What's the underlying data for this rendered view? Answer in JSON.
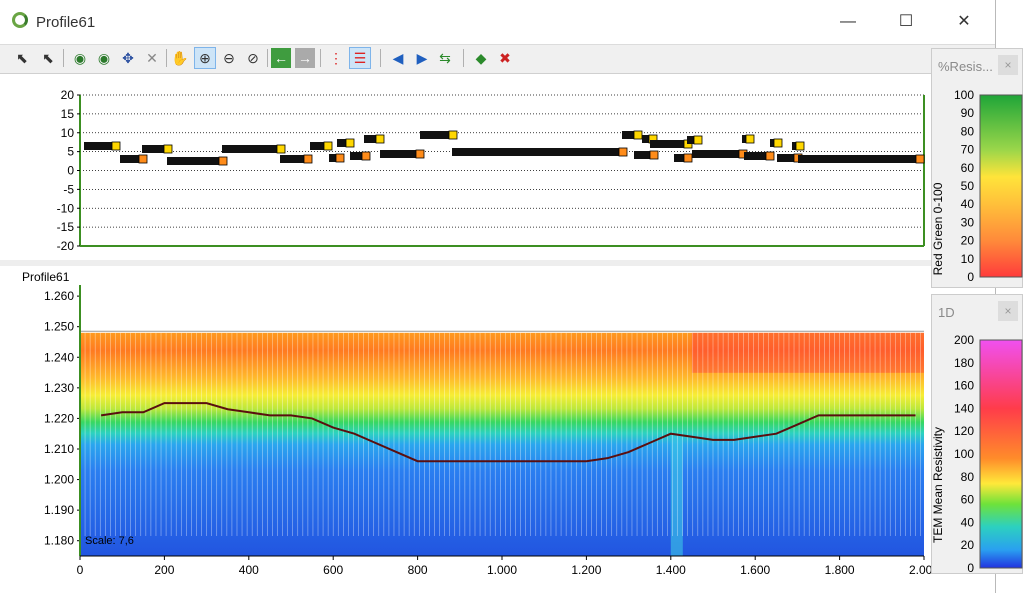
{
  "window": {
    "title": "Profile61",
    "minimize": "—",
    "maximize": "☐",
    "close": "✕"
  },
  "toolbar": {
    "icons": [
      "select-arrow-icon",
      "select-arrow-plus-icon",
      "globe-nav-icon",
      "globe-nav2-icon",
      "cursor-pick-icon",
      "delete-x-icon",
      "pan-hand-icon",
      "zoom-in-icon",
      "zoom-out-icon",
      "zoom-extent-icon",
      "back-arrow-icon",
      "forward-arrow-icon",
      "vertical-lines-icon",
      "horizontal-lines-icon",
      "previous-blue-icon",
      "next-blue-icon",
      "refresh-green-icon",
      "layer-green-icon",
      "layer-remove-icon"
    ]
  },
  "top_chart": {
    "y_ticks": [
      "20",
      "15",
      "10",
      "5",
      "0",
      "-5",
      "-10",
      "-15",
      "-20"
    ],
    "y_values": [
      20,
      15,
      10,
      5,
      0,
      -5,
      -10,
      -15,
      -20
    ]
  },
  "bottom_chart": {
    "profile_label": "Profile61",
    "scale_label": "Scale: 7,6",
    "y_ticks": [
      "1.260",
      "1.250",
      "1.240",
      "1.230",
      "1.220",
      "1.210",
      "1.200",
      "1.190",
      "1.180"
    ],
    "x_ticks": [
      "0",
      "200",
      "400",
      "600",
      "800",
      "1.000",
      "1.200",
      "1.400",
      "1.600",
      "1.800",
      "2.000"
    ]
  },
  "legend_top": {
    "title": "%Resis...",
    "close": "×",
    "axis_label": "Red Green 0-100",
    "ticks": [
      "100",
      "90",
      "80",
      "70",
      "60",
      "50",
      "40",
      "30",
      "20",
      "10",
      "0"
    ]
  },
  "legend_bottom": {
    "title": "1D",
    "close": "×",
    "axis_label": "TEM Mean Resistivity",
    "ticks": [
      "200",
      "180",
      "160",
      "140",
      "120",
      "100",
      "80",
      "60",
      "40",
      "20",
      "0"
    ]
  },
  "chart_data": {
    "type": "line",
    "title": "",
    "xlabel": "",
    "ylabel": "",
    "x": [
      50,
      100,
      150,
      200,
      250,
      300,
      350,
      400,
      450,
      500,
      550,
      600,
      650,
      700,
      750,
      800,
      850,
      900,
      950,
      1000,
      1050,
      1100,
      1150,
      1200,
      1250,
      1300,
      1350,
      1400,
      1450,
      1500,
      1550,
      1600,
      1650,
      1700,
      1750,
      1800,
      1850,
      1900,
      1950,
      1980
    ],
    "series": [
      {
        "values": [
          1.221,
          1.222,
          1.222,
          1.225,
          1.225,
          1.225,
          1.223,
          1.222,
          1.221,
          1.221,
          1.22,
          1.217,
          1.215,
          1.212,
          1.209,
          1.206,
          1.206,
          1.206,
          1.206,
          1.206,
          1.206,
          1.206,
          1.206,
          1.206,
          1.207,
          1.209,
          1.212,
          1.215,
          1.214,
          1.213,
          1.213,
          1.214,
          1.215,
          1.218,
          1.221,
          1.221,
          1.221,
          1.221,
          1.221,
          1.221
        ]
      }
    ],
    "xlim": [
      0,
      2000
    ],
    "ylim": [
      1.175,
      1.26
    ],
    "grid": true
  },
  "colors": {
    "curve": "#5a0f0f",
    "axis_green": "#3c8f22"
  }
}
